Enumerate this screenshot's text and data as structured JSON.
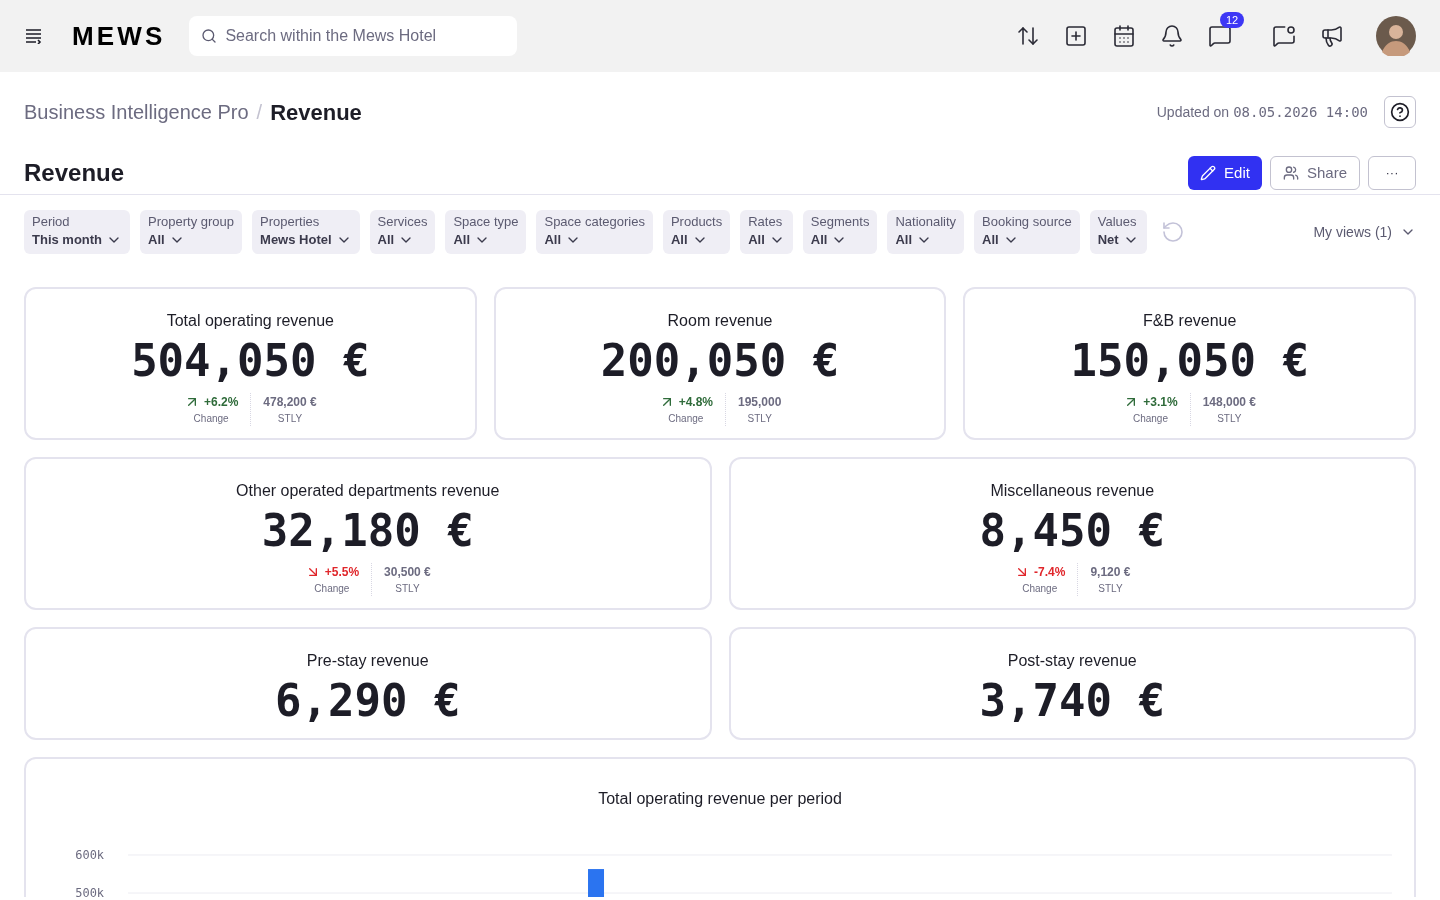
{
  "header": {
    "logo": "MEWS",
    "search": {
      "placeholder": "Search within the Mews Hotel"
    },
    "notifications_badge": "12"
  },
  "breadcrumb": {
    "parent": "Business Intelligence Pro",
    "separator": "/",
    "current": "Revenue"
  },
  "updated": {
    "label": "Updated on",
    "timestamp": "08.05.2026 14:00"
  },
  "page_title": "Revenue",
  "actions": {
    "edit": "Edit",
    "share": "Share",
    "more": "···"
  },
  "filters": [
    {
      "label": "Period",
      "value": "This month"
    },
    {
      "label": "Property group",
      "value": "All"
    },
    {
      "label": "Properties",
      "value": "Mews Hotel"
    },
    {
      "label": "Services",
      "value": "All"
    },
    {
      "label": "Space type",
      "value": "All"
    },
    {
      "label": "Space categories",
      "value": "All"
    },
    {
      "label": "Products",
      "value": "All"
    },
    {
      "label": "Rates",
      "value": "All"
    },
    {
      "label": "Segments",
      "value": "All"
    },
    {
      "label": "Nationality",
      "value": "All"
    },
    {
      "label": "Booking source",
      "value": "All"
    },
    {
      "label": "Values",
      "value": "Net"
    }
  ],
  "my_views": "My views (1)",
  "kpi_rows": [
    [
      {
        "title": "Total operating revenue",
        "value": "504,050 €",
        "change": "+6.2%",
        "kind": "up",
        "change_label": "Change",
        "stly": "478,200 €",
        "stly_label": "STLY"
      },
      {
        "title": "Room revenue",
        "value": "200,050 €",
        "change": "+4.8%",
        "kind": "up",
        "change_label": "Change",
        "stly": "195,000",
        "stly_label": "STLY"
      },
      {
        "title": "F&B revenue",
        "value": "150,050 €",
        "change": "+3.1%",
        "kind": "up",
        "change_label": "Change",
        "stly": "148,000 €",
        "stly_label": "STLY"
      }
    ],
    [
      {
        "title": "Other operated departments revenue",
        "value": "32,180 €",
        "change": "+5.5%",
        "kind": "down",
        "change_label": "Change",
        "stly": "30,500 €",
        "stly_label": "STLY"
      },
      {
        "title": "Miscellaneous revenue",
        "value": "8,450 €",
        "change": "-7.4%",
        "kind": "down",
        "change_label": "Change",
        "stly": "9,120 €",
        "stly_label": "STLY"
      }
    ],
    [
      {
        "title": "Pre-stay revenue",
        "value": "6,290 €"
      },
      {
        "title": "Post-stay revenue",
        "value": "3,740 €"
      }
    ]
  ],
  "chart": {
    "chart_data": {
      "type": "bar",
      "title": "Total operating revenue per period",
      "ylim": [
        480000,
        600000
      ],
      "yticks": [
        {
          "value": 600000,
          "label": "600k"
        },
        {
          "value": 500000,
          "label": "500k"
        }
      ],
      "series": [
        {
          "color": "#2b74f0",
          "values": [
            563000
          ]
        }
      ]
    }
  }
}
